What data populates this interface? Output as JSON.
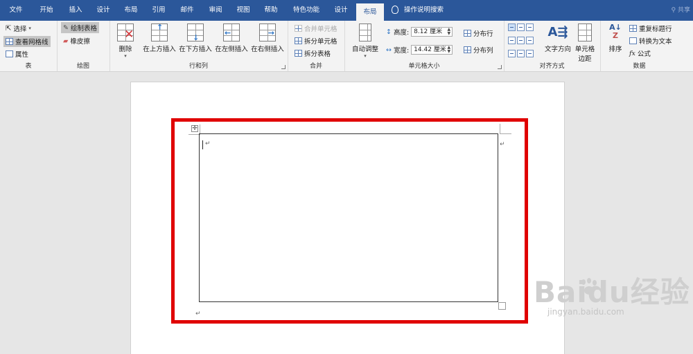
{
  "tabs": [
    "文件",
    "开始",
    "插入",
    "设计",
    "布局",
    "引用",
    "邮件",
    "审阅",
    "视图",
    "帮助",
    "特色功能",
    "设计",
    "布局"
  ],
  "active_tab": "布局",
  "tell_me": "操作说明搜索",
  "share": "共享",
  "groups": {
    "table": {
      "label": "表",
      "select": "选择",
      "gridlines": "查看网格线",
      "properties": "属性"
    },
    "draw": {
      "label": "绘图",
      "draw_table": "绘制表格",
      "eraser": "橡皮擦"
    },
    "rows_cols": {
      "label": "行和列",
      "delete": "删除",
      "insert_above": "在上方插入",
      "insert_below": "在下方插入",
      "insert_left": "在左侧插入",
      "insert_right": "在右侧插入"
    },
    "merge": {
      "label": "合并",
      "merge_cells": "合并单元格",
      "split_cells": "拆分单元格",
      "split_table": "拆分表格"
    },
    "cell_size": {
      "label": "单元格大小",
      "autofit": "自动调整",
      "height_label": "高度:",
      "height_value": "8.12 厘米",
      "width_label": "宽度:",
      "width_value": "14.42 厘米",
      "distribute_rows": "分布行",
      "distribute_cols": "分布列"
    },
    "alignment": {
      "label": "对齐方式",
      "text_direction": "文字方向",
      "cell_margins_1": "单元格",
      "cell_margins_2": "边距"
    },
    "data": {
      "label": "数据",
      "sort": "排序",
      "repeat_header": "重复标题行",
      "convert_text": "转换为文本",
      "formula": "公式"
    }
  },
  "document": {
    "paragraph_mark": "↵"
  },
  "watermark": {
    "brand": "Baidu经验",
    "url": "jingyan.baidu.com"
  },
  "colors": {
    "title_bar": "#2b579a",
    "highlight": "#e00000"
  }
}
